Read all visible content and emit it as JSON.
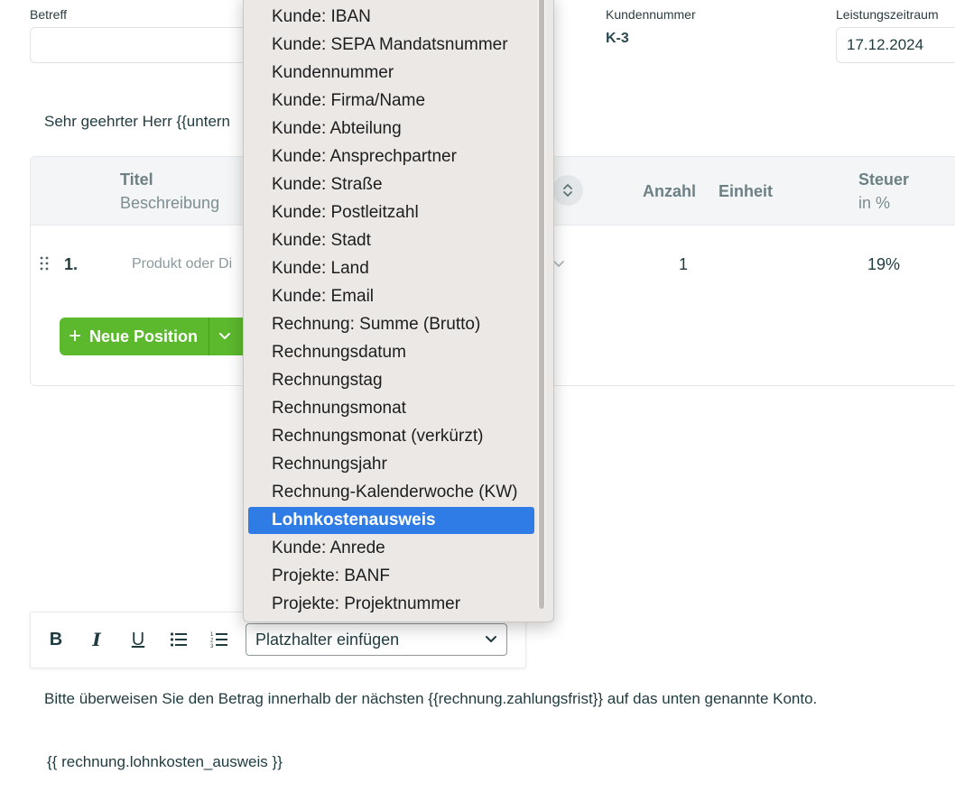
{
  "header": {
    "subject_label": "Betreff",
    "subject_value": "",
    "customer_number_label": "Kundennummer",
    "customer_number_value": "K-3",
    "service_period_label": "Leistungszeitraum",
    "service_period_value": "17.12.2024"
  },
  "greeting": "Sehr geehrter Herr {{untern",
  "positions_table": {
    "col_title": "Titel",
    "col_description": "Beschreibung",
    "col_quantity": "Anzahl",
    "col_unit": "Einheit",
    "col_tax": "Steuer",
    "col_tax_unit": "in %",
    "rows": [
      {
        "number": "1.",
        "product_placeholder": "Produkt oder Di",
        "quantity": "1",
        "tax": "19%"
      }
    ],
    "new_position_label": "Neue Position"
  },
  "toolbar": {
    "bold": "B",
    "italic": "I",
    "underline": "U",
    "placeholder_select_value": "Platzhalter einfügen"
  },
  "dropdown": {
    "selected_index": 18,
    "items": [
      "Kunde: IBAN",
      "Kunde: SEPA Mandatsnummer",
      "Kundennummer",
      "Kunde: Firma/Name",
      "Kunde: Abteilung",
      "Kunde: Ansprechpartner",
      "Kunde: Straße",
      "Kunde: Postleitzahl",
      "Kunde: Stadt",
      "Kunde: Land",
      "Kunde: Email",
      "Rechnung: Summe (Brutto)",
      "Rechnungsdatum",
      "Rechnungstag",
      "Rechnungsmonat",
      "Rechnungsmonat (verkürzt)",
      "Rechnungsjahr",
      "Rechnung-Kalenderwoche (KW)",
      "Lohnkostenausweis",
      "Kunde: Anrede",
      "Projekte: BANF",
      "Projekte: Projektnummer"
    ]
  },
  "body_text": {
    "line1": "Bitte überweisen Sie den Betrag innerhalb der nächsten {{rechnung.zahlungsfrist}} auf das unten genannte Konto.",
    "line2": "{{ rechnung.lohnkosten_ausweis }}"
  },
  "colors": {
    "accent_green": "#5cb82d",
    "selection_blue": "#2f7ce6",
    "text_dark": "#1f3b40"
  }
}
